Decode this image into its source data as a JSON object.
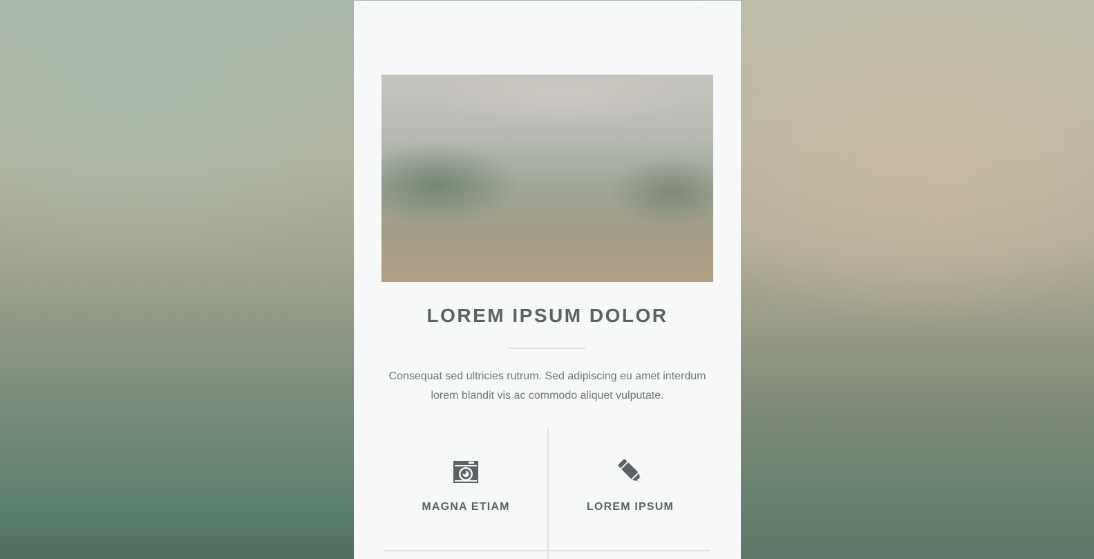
{
  "article": {
    "title": "LOREM IPSUM DOLOR",
    "description": "Consequat sed ultricies rutrum. Sed adipiscing eu amet interdum lorem blandit vis ac commodo aliquet vulputate."
  },
  "features": [
    {
      "icon": "camera-icon",
      "label": "MAGNA ETIAM"
    },
    {
      "icon": "pencil-icon",
      "label": "LOREM IPSUM"
    }
  ],
  "colors": {
    "heading": "#5b6263",
    "body_text": "#6f7677",
    "card_background": "#f7f8f8",
    "divider": "#dfe1e1"
  }
}
